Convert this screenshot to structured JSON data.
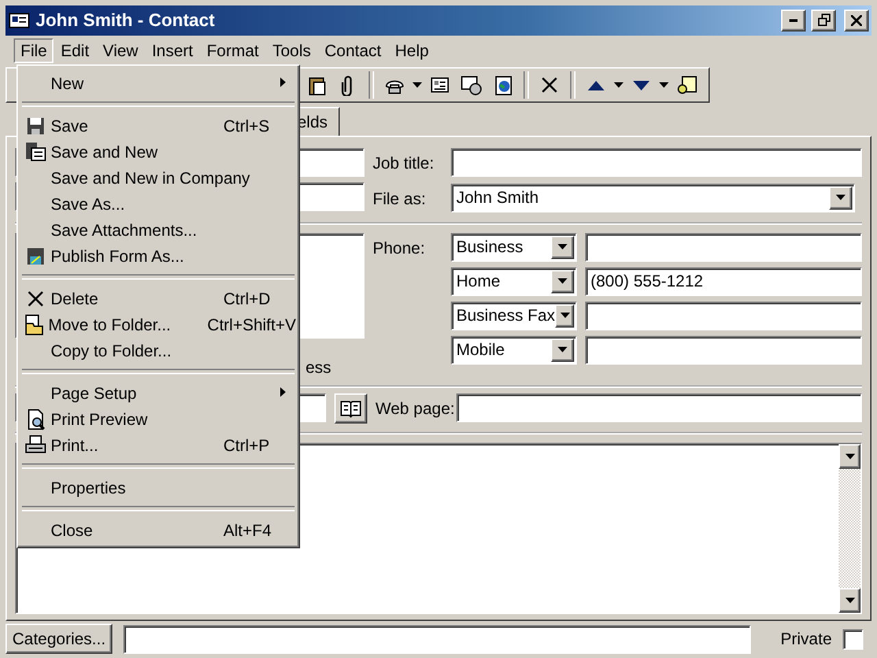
{
  "window": {
    "title": "John Smith - Contact"
  },
  "menubar": [
    {
      "label": "File",
      "selected": true
    },
    {
      "label": "Edit",
      "selected": false
    },
    {
      "label": "View",
      "selected": false
    },
    {
      "label": "Insert",
      "selected": false
    },
    {
      "label": "Format",
      "selected": false
    },
    {
      "label": "Tools",
      "selected": false
    },
    {
      "label": "Contact",
      "selected": false
    },
    {
      "label": "Help",
      "selected": false
    }
  ],
  "tabs": [
    {
      "label": "elds",
      "selected": false
    }
  ],
  "form": {
    "job_title_label": "Job title:",
    "file_as_label": "File as:",
    "file_as_value": "John Smith",
    "phone_label": "Phone:",
    "phones": [
      {
        "type": "Business"
      },
      {
        "type": "Home",
        "number": "(800) 555-1212"
      },
      {
        "type": "Business Fax"
      },
      {
        "type": "Mobile"
      }
    ],
    "address_note": "ess",
    "web_page_label": "Web page:"
  },
  "footer": {
    "categories_button": "Categories...",
    "private_label": "Private",
    "private_checked": false
  },
  "file_menu": [
    {
      "kind": "item",
      "label": "New",
      "submenu": true
    },
    {
      "kind": "separator"
    },
    {
      "kind": "item",
      "label": "Save",
      "shortcut": "Ctrl+S"
    },
    {
      "kind": "item",
      "label": "Save and New"
    },
    {
      "kind": "item",
      "label": "Save and New in Company"
    },
    {
      "kind": "item",
      "label": "Save As..."
    },
    {
      "kind": "item",
      "label": "Save Attachments..."
    },
    {
      "kind": "item",
      "label": "Publish Form As..."
    },
    {
      "kind": "separator"
    },
    {
      "kind": "item",
      "label": "Delete",
      "shortcut": "Ctrl+D"
    },
    {
      "kind": "item",
      "label": "Move to Folder...",
      "shortcut": "Ctrl+Shift+V"
    },
    {
      "kind": "item",
      "label": "Copy to Folder..."
    },
    {
      "kind": "separator"
    },
    {
      "kind": "item",
      "label": "Page Setup",
      "submenu": true
    },
    {
      "kind": "item",
      "label": "Print Preview"
    },
    {
      "kind": "item",
      "label": "Print...",
      "shortcut": "Ctrl+P"
    },
    {
      "kind": "separator"
    },
    {
      "kind": "item",
      "label": "Properties"
    },
    {
      "kind": "separator"
    },
    {
      "kind": "item",
      "label": "Close",
      "shortcut": "Alt+F4"
    }
  ]
}
